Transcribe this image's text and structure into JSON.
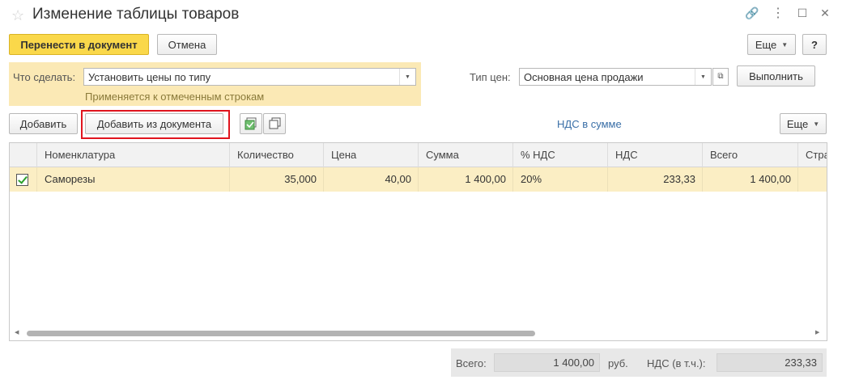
{
  "window": {
    "title": "Изменение таблицы товаров",
    "more_label": "Еще",
    "help_label": "?"
  },
  "toolbar": {
    "transfer_label": "Перенести в документ",
    "cancel_label": "Отмена"
  },
  "panel": {
    "action_label": "Что сделать:",
    "action_value": "Установить цены по типу",
    "hint": "Применяется к отмеченным строкам",
    "price_type_label": "Тип цен:",
    "price_type_value": "Основная цена продажи",
    "execute_label": "Выполнить"
  },
  "table_toolbar": {
    "add_label": "Добавить",
    "add_from_doc_label": "Добавить из документа",
    "vat_link": "НДС в сумме",
    "more_label": "Еще"
  },
  "table": {
    "columns": [
      "Номенклатура",
      "Количество",
      "Цена",
      "Сумма",
      "% НДС",
      "НДС",
      "Всего",
      "Стра"
    ],
    "rows": [
      {
        "checked": true,
        "item": "Саморезы",
        "quantity": "35,000",
        "price": "40,00",
        "sum": "1 400,00",
        "vat_rate": "20%",
        "vat": "233,33",
        "total": "1 400,00",
        "country": ""
      }
    ]
  },
  "footer": {
    "total_label": "Всего:",
    "total_value": "1 400,00",
    "currency": "руб.",
    "vat_label": "НДС (в т.ч.):",
    "vat_value": "233,33"
  },
  "colors": {
    "primary": "#fad84a",
    "panel_bg": "#fbe9b5",
    "selected_row": "#fbeec4",
    "link": "#3a6fa7",
    "highlight": "#e0141e"
  }
}
